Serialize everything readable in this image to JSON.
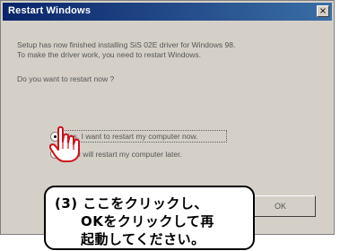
{
  "window": {
    "title": "Restart Windows",
    "close_glyph": "×"
  },
  "message": {
    "line1": "Setup has now finished installing SiS 02E driver for Windows 98.",
    "line2": "To make the driver work, you need to restart Windows.",
    "question": "Do you want to restart now ?"
  },
  "options": [
    {
      "label": "Yes, I want to restart my computer now.",
      "selected": true
    },
    {
      "label": "No, I will restart my computer later.",
      "selected": false
    }
  ],
  "buttons": {
    "ok_label": "OK"
  },
  "callout": {
    "line1": "(3) ここをクリックし、",
    "line2": "OKをクリックして再",
    "line3": "起動してください。"
  },
  "icons": {
    "pointer": "hand-pointer-icon"
  }
}
